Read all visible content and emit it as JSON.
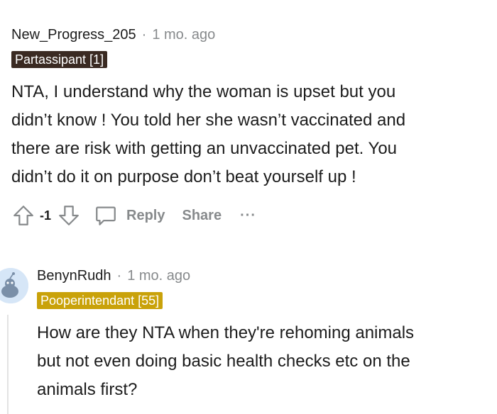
{
  "comment1": {
    "username": "New_Progress_205",
    "separator": "·",
    "time": "1 mo. ago",
    "flair": "Partassipant [1]",
    "body_lines": [
      "NTA, I understand why the woman is upset but you",
      "didn’t know ! You told her she wasn’t vaccinated and",
      "there are risk with getting an unvaccinated pet. You",
      "didn’t do it on purpose don’t beat yourself up !"
    ],
    "score": "-1",
    "reply_label": "Reply",
    "share_label": "Share",
    "more_label": "···"
  },
  "comment2": {
    "username": "BenynRudh",
    "separator": "·",
    "time": "1 mo. ago",
    "flair": "Pooperintendant [55]",
    "body_lines": [
      "How are they NTA when they're rehoming animals",
      "but not even doing basic health checks etc on the",
      "animals first?"
    ]
  },
  "colors": {
    "flair_dark": "#3a2a22",
    "flair_gold": "#c9a20a",
    "meta_gray": "#878a8c"
  }
}
